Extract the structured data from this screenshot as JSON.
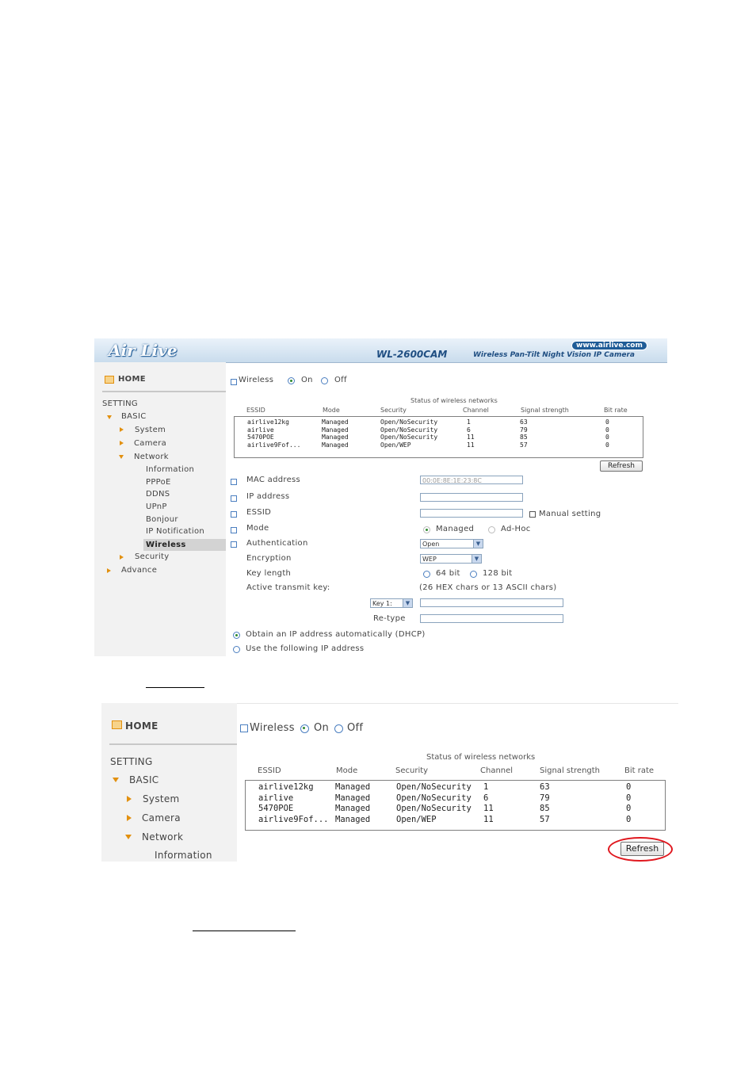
{
  "shot1": {
    "banner": {
      "logo": "Air Live",
      "model": "WL-2600CAM",
      "tagline": "Wireless Pan-Tilt Night Vision IP Camera",
      "url": "www.airlive.com"
    },
    "nav": {
      "home": "HOME",
      "setting": "SETTING",
      "basic": "BASIC",
      "system": "System",
      "camera": "Camera",
      "network": "Network",
      "information": "Information",
      "pppoe": "PPPoE",
      "ddns": "DDNS",
      "upnp": "UPnP",
      "bonjour": "Bonjour",
      "ip_notification": "IP Notification",
      "wireless": "Wireless",
      "security": "Security",
      "advance": "Advance"
    },
    "wireless_label": "Wireless",
    "on_label": "On",
    "off_label": "Off",
    "status_title": "Status of wireless networks",
    "columns": [
      "ESSID",
      "Mode",
      "Security",
      "Channel",
      "Signal strength",
      "Bit rate"
    ],
    "networks": [
      [
        "airlive12kg",
        "Managed",
        "Open/NoSecurity",
        "1",
        "63",
        "0"
      ],
      [
        "airlive",
        "Managed",
        "Open/NoSecurity",
        "6",
        "79",
        "0"
      ],
      [
        "5470POE",
        "Managed",
        "Open/NoSecurity",
        "11",
        "85",
        "0"
      ],
      [
        "airlive9Fof...",
        "Managed",
        "Open/WEP",
        "11",
        "57",
        "0"
      ]
    ],
    "refresh_label": "Refresh",
    "mac_label": "MAC address",
    "mac_value": "00:0E:8E:1E:23:8C",
    "ip_label": "IP address",
    "essid_label": "ESSID",
    "manual_label": "Manual setting",
    "mode_label": "Mode",
    "managed_label": "Managed",
    "adhoc_label": "Ad-Hoc",
    "auth_label": "Authentication",
    "auth_value": "Open",
    "enc_label": "Encryption",
    "enc_value": "WEP",
    "keylen_label": "Key length",
    "bit64_label": "64 bit",
    "bit128_label": "128 bit",
    "active_key_label": "Active transmit key:",
    "hex_hint": "(26 HEX chars or 13 ASCII chars)",
    "key_select_value": "Key 1:",
    "retype_label": "Re-type",
    "dhcp_label": "Obtain an IP address automatically (DHCP)",
    "static_label": "Use the following IP address"
  },
  "shot2": {
    "nav": {
      "home": "HOME",
      "setting": "SETTING",
      "basic": "BASIC",
      "system": "System",
      "camera": "Camera",
      "network": "Network",
      "information": "Information"
    },
    "wireless_label": "Wireless",
    "on_label": "On",
    "off_label": "Off",
    "status_title": "Status of wireless networks",
    "columns": [
      "ESSID",
      "Mode",
      "Security",
      "Channel",
      "Signal strength",
      "Bit rate"
    ],
    "networks": [
      [
        "airlive12kg",
        "Managed",
        "Open/NoSecurity",
        "1",
        "63",
        "0"
      ],
      [
        "airlive",
        "Managed",
        "Open/NoSecurity",
        "6",
        "79",
        "0"
      ],
      [
        "5470POE",
        "Managed",
        "Open/NoSecurity",
        "11",
        "85",
        "0"
      ],
      [
        "airlive9Fof...",
        "Managed",
        "Open/WEP",
        "11",
        "57",
        "0"
      ]
    ],
    "refresh_label": "Refresh"
  },
  "colors": {
    "accent_blue": "#1f4e82",
    "highlight_red": "#e0171e",
    "nav_arrow": "#e2900f"
  }
}
